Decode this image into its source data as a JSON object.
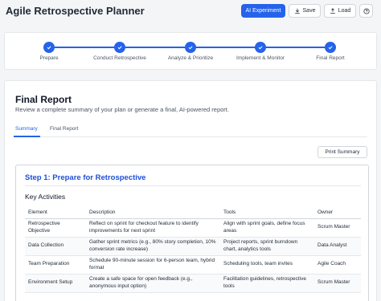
{
  "header": {
    "title": "Agile Retrospective Planner",
    "ai_button": "AI Experiment",
    "save_label": "Save",
    "load_label": "Load",
    "help_icon": "help-circle-icon"
  },
  "stepper": {
    "steps": [
      {
        "label": "Prepare",
        "completed": true
      },
      {
        "label": "Conduct Retrospective",
        "completed": true
      },
      {
        "label": "Analyze & Prioritize",
        "completed": true
      },
      {
        "label": "Implement & Monitor",
        "completed": true
      },
      {
        "label": "Final Report",
        "completed": true
      }
    ]
  },
  "report": {
    "title": "Final Report",
    "subtitle": "Review a complete summary of your plan or generate a final, AI-powered report.",
    "tabs": [
      {
        "label": "Summary",
        "active": true
      },
      {
        "label": "Final Report",
        "active": false
      }
    ],
    "print_label": "Print Summary"
  },
  "summary": {
    "step_heading": "Step 1: Prepare for Retrospective",
    "activities_heading": "Key Activities",
    "columns": [
      "Element",
      "Description",
      "Tools",
      "Owner"
    ],
    "rows": [
      [
        "Retrospective Objective",
        "Reflect on sprint for checkout feature to identify improvements for next sprint",
        "Align with sprint goals, define focus areas",
        "Scrum Master"
      ],
      [
        "Data Collection",
        "Gather sprint metrics (e.g., 80% story completion, 10% conversion rate increase)",
        "Project reports, sprint burndown chart, analytics tools",
        "Data Analyst"
      ],
      [
        "Team Preparation",
        "Schedule 90-minute session for 6-person team, hybrid format",
        "Scheduling tools, team invites",
        "Agile Coach"
      ],
      [
        "Environment Setup",
        "Create a safe space for open feedback (e.g., anonymous input option)",
        "Facilitation guidelines, retrospective tools",
        "Scrum Master"
      ]
    ]
  },
  "colors": {
    "accent": "#2563eb",
    "heading_blue": "#1d4ed8"
  }
}
